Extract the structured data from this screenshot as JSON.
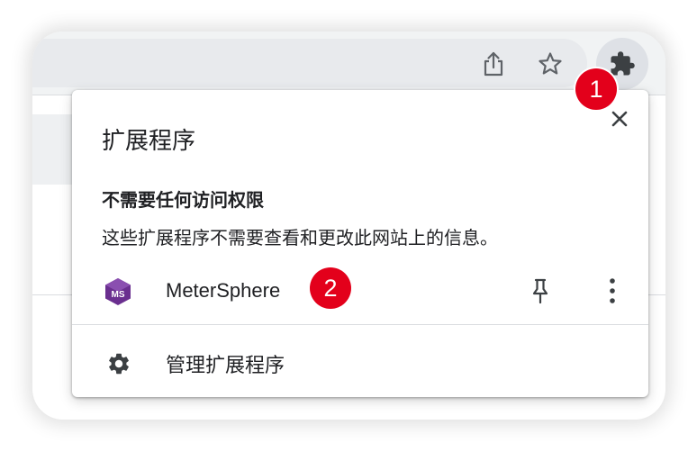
{
  "toolbar": {
    "share_icon": "share-icon",
    "bookmark_icon": "star-icon",
    "extensions_icon": "puzzle-icon"
  },
  "badges": {
    "first": "1",
    "second": "2"
  },
  "popup": {
    "title": "扩展程序",
    "close_icon": "close-icon",
    "section_heading": "不需要任何访问权限",
    "section_desc": "这些扩展程序不需要查看和更改此网站上的信息。",
    "extension": {
      "name": "MeterSphere",
      "logo_text": "MS",
      "logo_color": "#6a2f8f"
    },
    "manage_label": "管理扩展程序"
  },
  "colors": {
    "badge": "#e3001b",
    "toolbar": "#f1f3f4",
    "icon": "#5f6368"
  }
}
